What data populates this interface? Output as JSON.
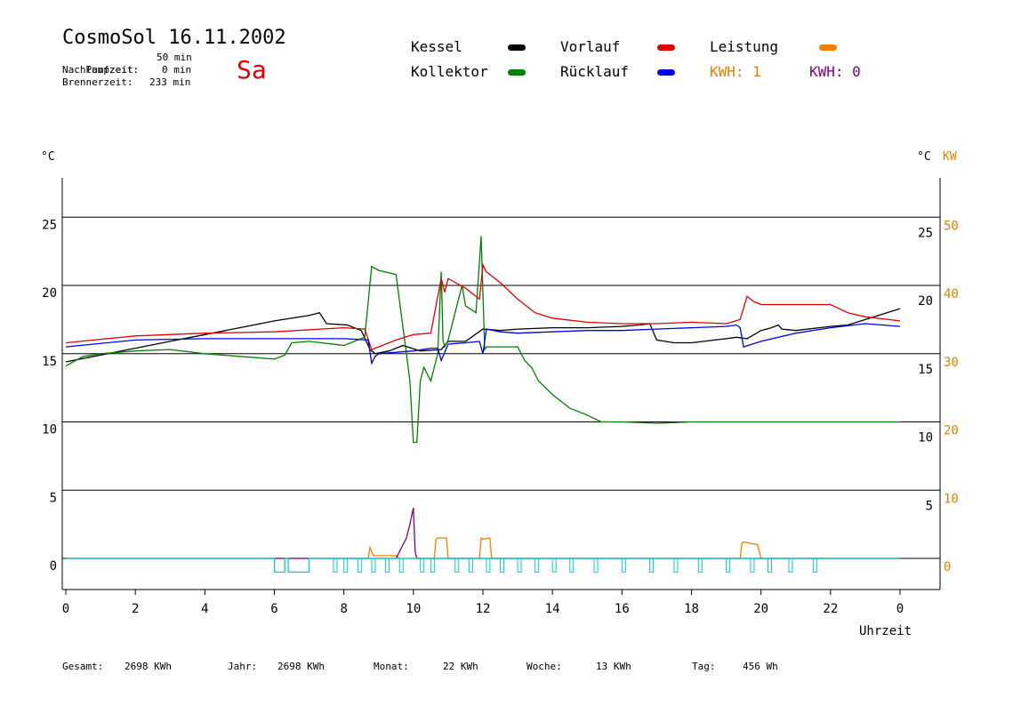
{
  "header": {
    "title": "CosmoSol 16.11.2002",
    "day": "Sa",
    "info": [
      {
        "label": "Pumpzeit:",
        "value": "50 min"
      },
      {
        "label": "Nachlaufzeit:",
        "value": "0 min"
      },
      {
        "label": "Brennerzeit:",
        "value": "233 min"
      }
    ]
  },
  "legend": {
    "kessel": {
      "label": "Kessel",
      "color": "#000000"
    },
    "vorlauf": {
      "label": "Vorlauf",
      "color": "#e00000"
    },
    "leistung": {
      "label": "Leistung",
      "color": "#f08000"
    },
    "kollektor": {
      "label": "Kollektor",
      "color": "#008000"
    },
    "ruecklauf": {
      "label": "Rücklauf",
      "color": "#0000e0"
    },
    "kwh1": {
      "label": "KWH: 1",
      "color": "#e08000"
    },
    "kwh2": {
      "label": "KWH: 0",
      "color": "#800080"
    }
  },
  "footer": {
    "gesamt": {
      "label": "Gesamt:",
      "value": "2698 KWh"
    },
    "jahr": {
      "label": "Jahr:",
      "value": "2698 KWh"
    },
    "monat": {
      "label": "Monat:",
      "value": "22 KWh"
    },
    "woche": {
      "label": "Woche:",
      "value": "13 KWh"
    },
    "tag": {
      "label": "Tag:",
      "value": "456 Wh"
    }
  },
  "chart_data": {
    "type": "line",
    "xlabel": "Uhrzeit",
    "ylabel_left": "°C",
    "ylabel_right": "°C",
    "ylabel_right2": "KW",
    "xlim": [
      0,
      24
    ],
    "ylim": [
      -2,
      28
    ],
    "x_ticks": [
      "0",
      "2",
      "4",
      "6",
      "8",
      "10",
      "12",
      "14",
      "16",
      "18",
      "20",
      "22",
      "0"
    ],
    "y_ticks_left": [
      "0",
      "5",
      "10",
      "15",
      "20",
      "25"
    ],
    "y_ticks_right": [
      "5",
      "10",
      "15",
      "20",
      "25"
    ],
    "y_ticks_kw": [
      "0",
      "10",
      "20",
      "30",
      "40",
      "50"
    ],
    "gridlines_y": [
      0,
      5,
      10,
      15,
      20,
      25
    ],
    "colors": {
      "kessel": "#000000",
      "kollektor": "#008000",
      "vorlauf": "#e00000",
      "ruecklauf": "#0000e0",
      "leistung": "#f08000",
      "kwh": "#800080",
      "pump": "#00d0d0"
    },
    "series": [
      {
        "name": "Kessel",
        "key": "kessel",
        "x": [
          0,
          1,
          2,
          3,
          4,
          5,
          6,
          7,
          7.3,
          7.5,
          8.1,
          8.5,
          8.75,
          8.9,
          9.3,
          9.7,
          10.2,
          10.8,
          11,
          11.5,
          12,
          12.5,
          13,
          14,
          15,
          16,
          16.5,
          16.8,
          17,
          17.5,
          18,
          19,
          19.3,
          19.6,
          20,
          20.3,
          20.5,
          20.6,
          21,
          22,
          22.5,
          23,
          24
        ],
        "y": [
          14.4,
          14.9,
          15.4,
          15.9,
          16.4,
          16.9,
          17.4,
          17.8,
          18.0,
          17.2,
          17.1,
          16.7,
          15.3,
          15.0,
          15.2,
          15.6,
          15.2,
          15.3,
          15.9,
          15.9,
          16.8,
          16.7,
          16.8,
          16.9,
          16.9,
          17.0,
          17.1,
          17.2,
          16.0,
          15.8,
          15.8,
          16.1,
          16.2,
          16.1,
          16.7,
          16.9,
          17.1,
          16.8,
          16.7,
          17.0,
          17.1,
          17.5,
          18.3
        ]
      },
      {
        "name": "Kollektor",
        "key": "kollektor",
        "x": [
          0,
          0.5,
          1,
          2,
          3,
          4,
          5,
          6,
          6.3,
          6.5,
          7,
          8,
          8.6,
          8.8,
          8.85,
          9,
          9.5,
          9.8,
          9.9,
          10.0,
          10.1,
          10.2,
          10.3,
          10.5,
          10.6,
          10.7,
          10.8,
          10.85,
          10.9,
          11.0,
          11.2,
          11.4,
          11.5,
          11.8,
          11.95,
          12.05,
          12.1,
          12.5,
          13,
          13.2,
          13.4,
          13.6,
          14,
          14.5,
          15,
          15.4,
          15.6,
          16,
          17,
          18,
          19,
          20,
          21,
          22,
          23,
          24
        ],
        "y": [
          14.1,
          14.8,
          15.0,
          15.2,
          15.3,
          15.0,
          14.8,
          14.6,
          14.9,
          15.8,
          15.9,
          15.6,
          16.2,
          21.4,
          21.3,
          21.1,
          20.8,
          15.0,
          13.0,
          8.5,
          8.5,
          13.0,
          14.0,
          13.0,
          14.0,
          15.0,
          21.0,
          16.0,
          15.5,
          16.0,
          18.0,
          20.0,
          18.5,
          18.0,
          23.6,
          15.3,
          15.5,
          15.5,
          15.5,
          14.5,
          14.0,
          13.0,
          12.0,
          11.0,
          10.5,
          10.0,
          10.0,
          10.0,
          9.9,
          10.0,
          10.0,
          10.0,
          10.0,
          10.0,
          10.0,
          10.0
        ]
      },
      {
        "name": "Vorlauf",
        "key": "vorlauf",
        "x": [
          0,
          2,
          4,
          6,
          8,
          8.6,
          8.8,
          9,
          9.5,
          10,
          10.5,
          10.8,
          10.9,
          11,
          11.5,
          11.9,
          12,
          12.1,
          12.5,
          13,
          13.5,
          14,
          15,
          16,
          17,
          18,
          19,
          19.4,
          19.6,
          19.8,
          20,
          21,
          22,
          22.5,
          23,
          24
        ],
        "y": [
          15.8,
          16.3,
          16.5,
          16.6,
          16.9,
          16.8,
          15.3,
          15.5,
          16.0,
          16.4,
          16.5,
          20.5,
          19.5,
          20.5,
          19.8,
          19.0,
          21.5,
          21.0,
          20.2,
          19.0,
          18.0,
          17.6,
          17.3,
          17.2,
          17.2,
          17.3,
          17.2,
          17.5,
          19.2,
          18.8,
          18.6,
          18.6,
          18.6,
          18.0,
          17.7,
          17.4
        ]
      },
      {
        "name": "Rücklauf",
        "key": "ruecklauf",
        "x": [
          0,
          2,
          4,
          6,
          8,
          8.7,
          8.8,
          8.9,
          9,
          9.5,
          10,
          10.5,
          10.7,
          10.8,
          11,
          11.5,
          11.9,
          12,
          12.1,
          12.5,
          13,
          14,
          15,
          16,
          17,
          18,
          19,
          19.3,
          19.4,
          19.5,
          20,
          21,
          22,
          23,
          24
        ],
        "y": [
          15.5,
          16.0,
          16.1,
          16.1,
          16.1,
          16.0,
          14.3,
          14.8,
          15.0,
          15.1,
          15.2,
          15.4,
          15.4,
          14.5,
          15.7,
          15.8,
          15.9,
          15.0,
          16.8,
          16.6,
          16.5,
          16.6,
          16.7,
          16.7,
          16.8,
          16.9,
          17.0,
          17.1,
          16.9,
          15.5,
          15.9,
          16.5,
          16.9,
          17.2,
          17.0
        ]
      },
      {
        "name": "Leistung",
        "key": "leistung",
        "x": [
          0,
          8.7,
          8.75,
          8.85,
          9.5,
          9.6,
          10.6,
          10.65,
          10.7,
          10.95,
          11.0,
          11.9,
          11.95,
          12.0,
          12.2,
          12.25,
          19.4,
          19.45,
          19.5,
          19.9,
          20.0,
          24
        ],
        "y": [
          0,
          0,
          0.8,
          0.2,
          0.2,
          0,
          0,
          1.4,
          1.5,
          1.5,
          0,
          0,
          1.5,
          1.4,
          1.5,
          0,
          0,
          1.1,
          1.2,
          1.0,
          0,
          0
        ]
      },
      {
        "name": "KWH",
        "key": "kwh",
        "x": [
          0,
          9.5,
          9.8,
          9.9,
          10.0,
          10.05,
          10.1,
          24
        ],
        "y": [
          0,
          0,
          1.5,
          2.5,
          3.7,
          0.5,
          0,
          0
        ]
      },
      {
        "name": "Pumpe",
        "key": "pump",
        "x": [
          0,
          6.0,
          6.0,
          6.3,
          6.3,
          6.4,
          6.4,
          7.0,
          7.0,
          24
        ],
        "y": [
          0,
          0,
          -1,
          -1,
          0,
          0,
          -1,
          -1,
          0,
          0
        ]
      }
    ]
  }
}
